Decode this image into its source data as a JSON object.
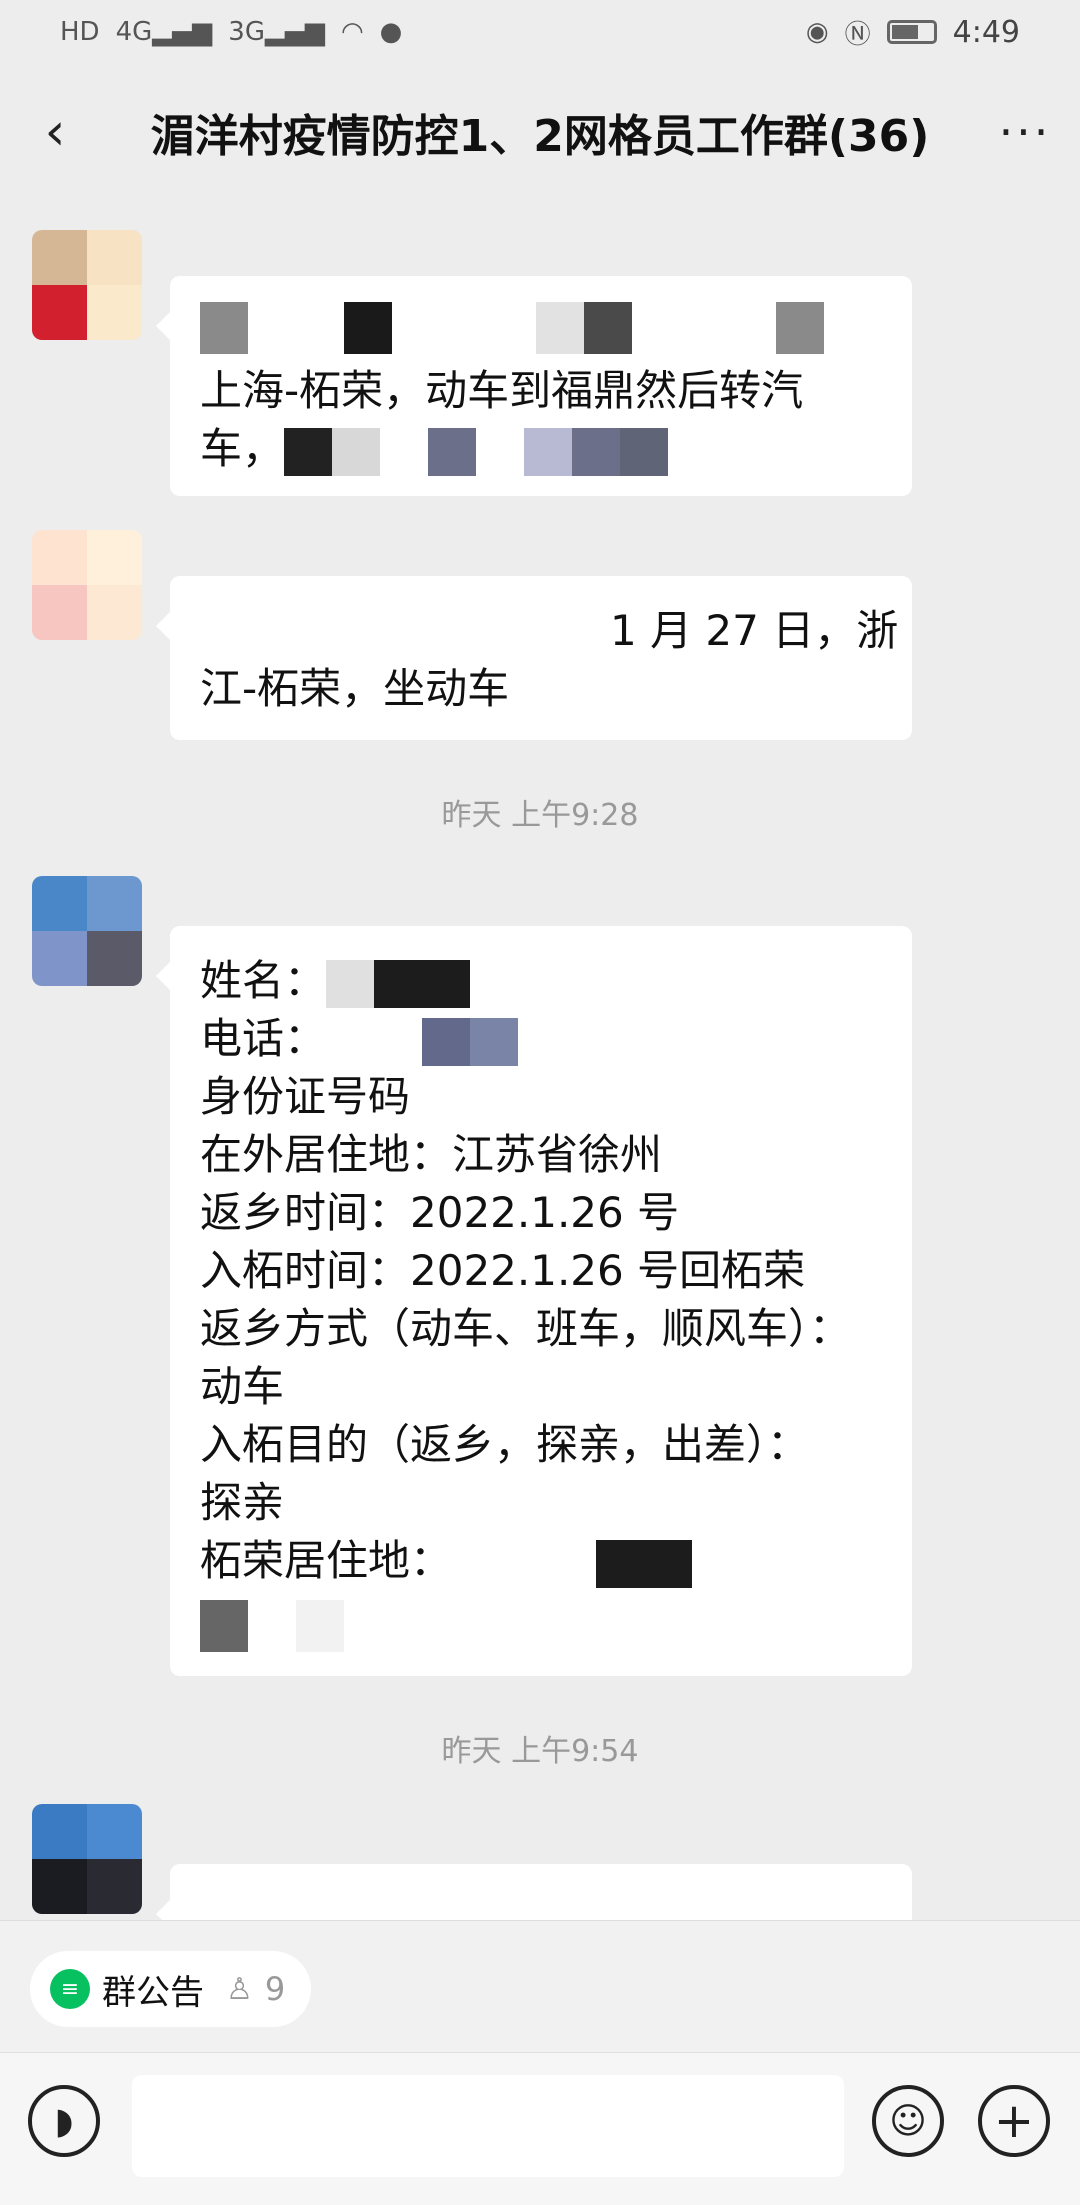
{
  "status": {
    "left_icons": [
      "HD",
      "4G",
      "3G",
      "wifi-icon",
      "message-icon"
    ],
    "network_1": "4G",
    "network_2": "3G",
    "hd": "HD",
    "time": "4:49"
  },
  "header": {
    "title": "湄洋村疫情防控1、2网格员工作群(36)",
    "back_icon": "‹",
    "more_icon": "···"
  },
  "messages": [
    {
      "lines": [
        "上海-柘荣，动车到福鼎然后转汽",
        "车，"
      ]
    },
    {
      "lines": [
        "1 月 27 日，浙",
        "江-柘荣，坐动车"
      ]
    },
    {
      "lines": [
        "姓名：",
        "电话：",
        "身份证号码",
        "在外居住地：江苏省徐州",
        "返乡时间：2022.1.26 号",
        "入柘时间：2022.1.26 号回柘荣",
        "返乡方式（动车、班车，顺风车）：",
        "动车",
        "入柘目的（返乡，探亲，出差）：",
        "探亲",
        "柘荣居住地："
      ]
    }
  ],
  "timestamps": [
    "昨天 上午9:28",
    "昨天 上午9:54"
  ],
  "notice": {
    "label": "群公告",
    "member_count": "9"
  },
  "colors": {
    "accent": "#07c160",
    "background": "#ededed",
    "bubble": "#ffffff"
  }
}
